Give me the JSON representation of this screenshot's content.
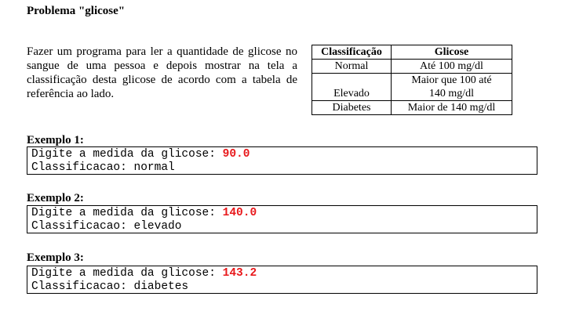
{
  "title": "Problema \"glicose\"",
  "description": "Fazer um programa para ler a quantidade de glicose no sangue de uma pessoa e depois mostrar na tela a classificação desta glicose de acordo com a tabela de referência ao lado.",
  "table": {
    "headers": [
      "Classificação",
      "Glicose"
    ],
    "rows": [
      {
        "cls": "Normal",
        "glucose": "Até 100 mg/dl"
      },
      {
        "cls": "Elevado",
        "glucose": "Maior que 100 até 140 mg/dl"
      },
      {
        "cls": "Diabetes",
        "glucose": "Maior de 140 mg/dl"
      }
    ]
  },
  "examples": [
    {
      "label": "Exemplo 1:",
      "prompt": "Digite a medida da glicose: ",
      "value": "90.0",
      "output": "Classificacao: normal"
    },
    {
      "label": "Exemplo 2:",
      "prompt": "Digite a medida da glicose: ",
      "value": "140.0",
      "output": "Classificacao: elevado"
    },
    {
      "label": "Exemplo 3:",
      "prompt": "Digite a medida da glicose: ",
      "value": "143.2",
      "output": "Classificacao: diabetes"
    }
  ]
}
